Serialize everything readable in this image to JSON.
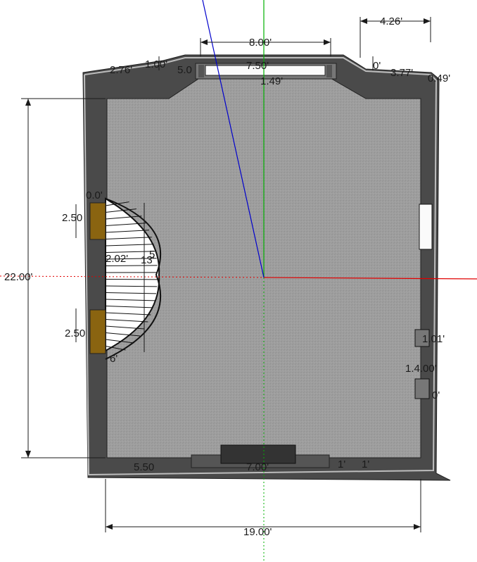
{
  "dimensions": {
    "total_height": "22.00'",
    "total_width": "19.00'",
    "window_width": "8.00'",
    "bay_offset": "4.26'",
    "left_top_a": "2.76'",
    "left_top_b": "1.00'",
    "left_top_c": "5.0",
    "mid_top": "7.50'",
    "mid_depth": "1.49'",
    "right_top_a": "0'",
    "right_top_b": "3.77'",
    "right_top_c": "0.49'",
    "arch_top": "0.0'",
    "arch_left_1": "2.50",
    "arch_left_2": "2.50",
    "arch_depth": "2.02'",
    "arch_radius": "13'",
    "arch_small": "5'",
    "arch_bottom": "6'",
    "right_wall_1": "1.01'",
    "right_wall_2": "1.4.00'",
    "right_wall_3": "0'",
    "bottom_left": "5.50",
    "bottom_mid": "7.00'",
    "bottom_right_a": "1'",
    "bottom_right_b": "1'"
  },
  "colors": {
    "floor": "#9c9c9c",
    "wall": "#4a4a4a",
    "door_panel": "#8a6410",
    "axis_red": "#e00000",
    "axis_green": "#00b000",
    "axis_blue": "#0000cc"
  }
}
